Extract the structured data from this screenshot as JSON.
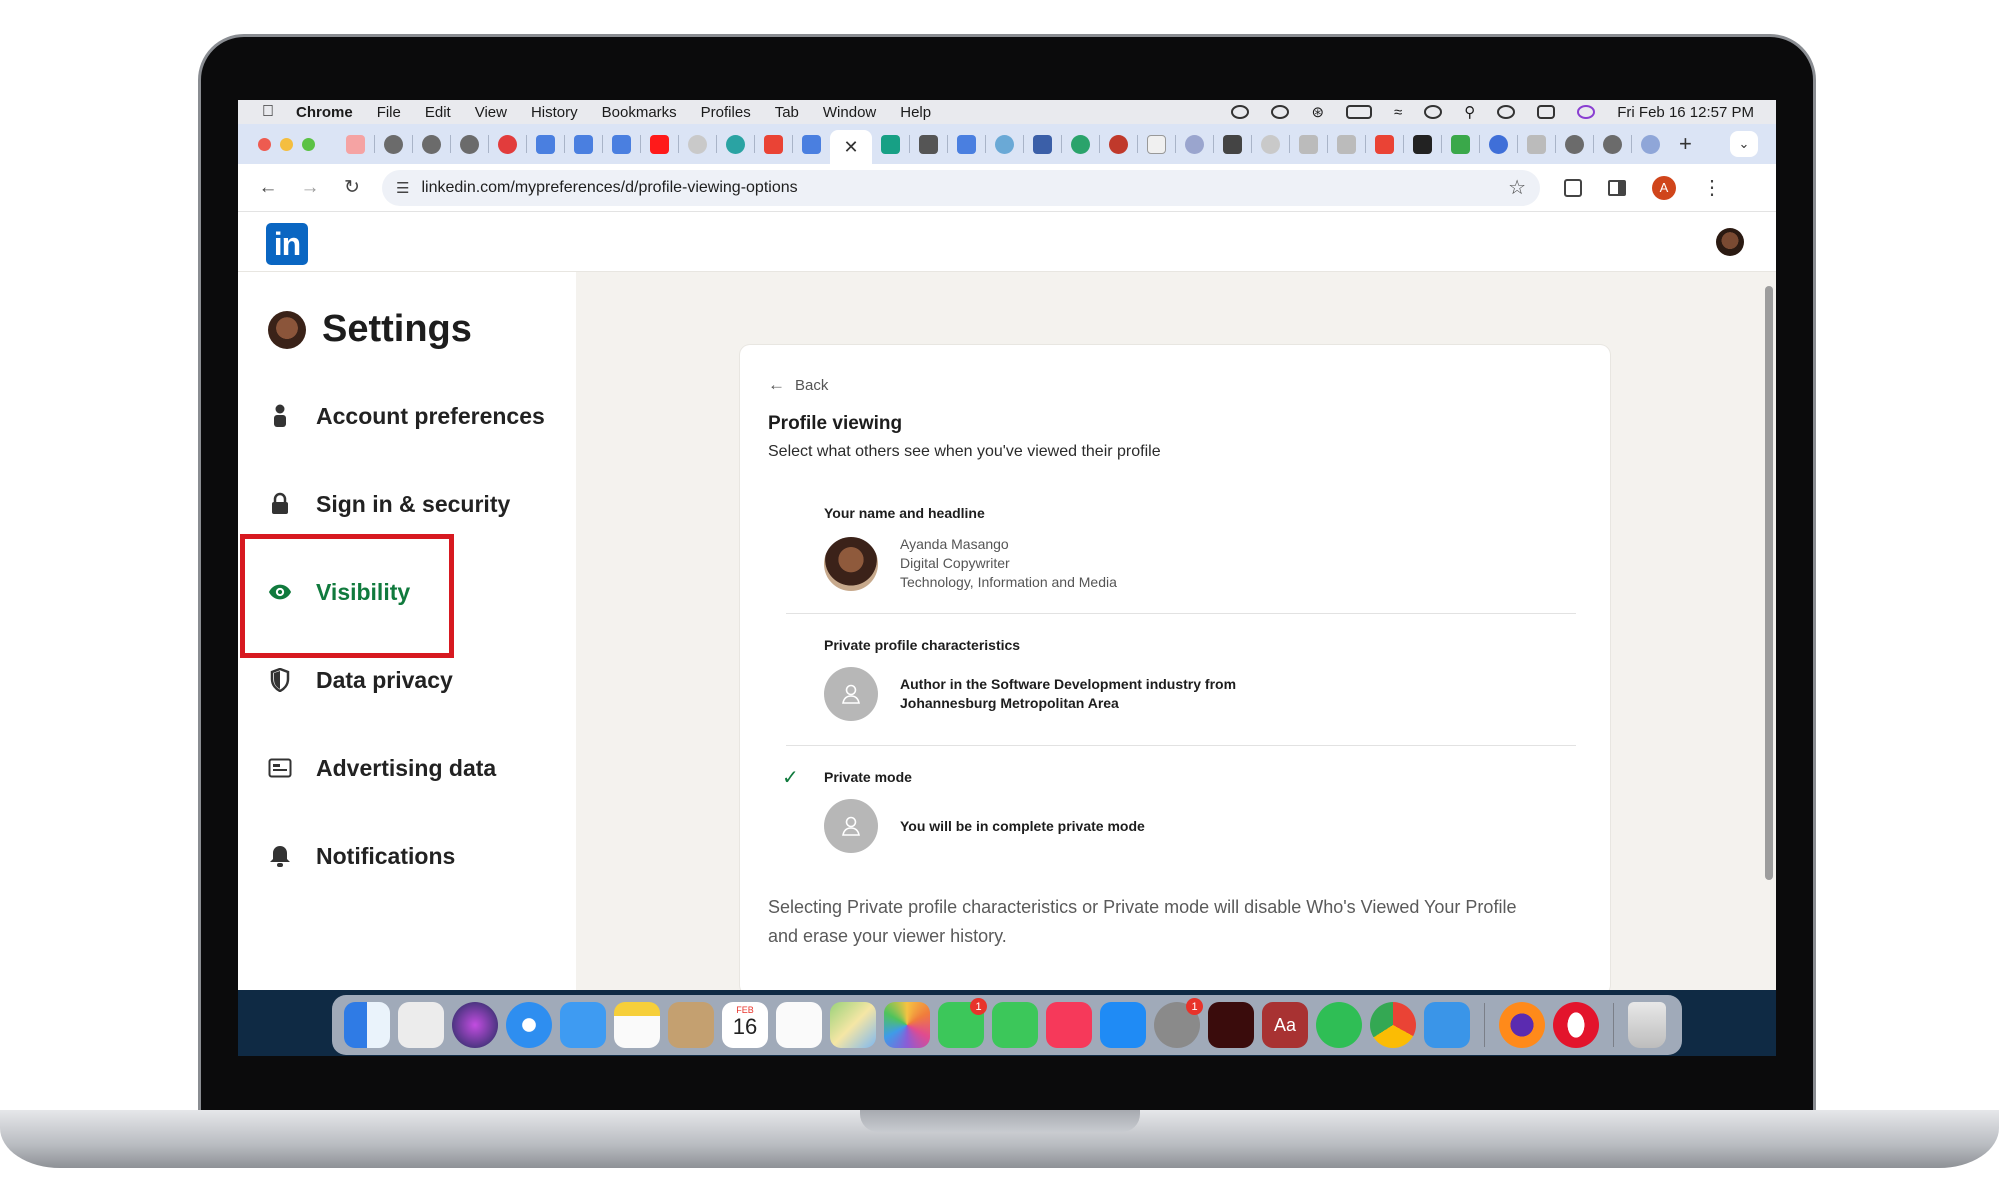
{
  "menubar": {
    "app": "Chrome",
    "items": [
      "File",
      "Edit",
      "View",
      "History",
      "Bookmarks",
      "Profiles",
      "Tab",
      "Window",
      "Help"
    ],
    "clock": "Fri Feb 16  12:57 PM"
  },
  "tabs": {
    "active_close": "✕",
    "new_tab": "+"
  },
  "toolbar": {
    "url": "linkedin.com/mypreferences/d/profile-viewing-options",
    "profile_initial": "A"
  },
  "linkedin": {
    "logo_text": "in"
  },
  "sidebar": {
    "title": "Settings",
    "items": [
      {
        "label": "Account preferences",
        "icon": "person-icon"
      },
      {
        "label": "Sign in & security",
        "icon": "lock-icon"
      },
      {
        "label": "Visibility",
        "icon": "eye-icon",
        "active": true
      },
      {
        "label": "Data privacy",
        "icon": "shield-icon"
      },
      {
        "label": "Advertising data",
        "icon": "ad-card-icon"
      },
      {
        "label": "Notifications",
        "icon": "bell-icon"
      }
    ]
  },
  "content": {
    "back": "Back",
    "title": "Profile viewing",
    "subtitle": "Select what others see when you've viewed their profile",
    "options": [
      {
        "title": "Your name and headline",
        "lines": [
          "Ayanda Masango",
          "Digital Copywriter",
          "Technology, Information and Media"
        ],
        "selected": false
      },
      {
        "title": "Private profile characteristics",
        "lines": [
          "Author in the Software Development industry from",
          "Johannesburg Metropolitan Area"
        ],
        "selected": false
      },
      {
        "title": "Private mode",
        "lines": [
          "You will be in complete private mode"
        ],
        "selected": true
      }
    ],
    "footnote": "Selecting Private profile characteristics or Private mode will disable Who's Viewed Your Profile and erase your viewer history."
  },
  "dock": {
    "calendar_month": "FEB",
    "calendar_day": "16",
    "facetime_badge": "1",
    "settings_badge": "1",
    "dictionary_label": "Aa"
  },
  "colors": {
    "linkedin_blue": "#0a66c2",
    "active_green": "#107a3d",
    "highlight_red": "#d71920",
    "page_bg": "#f4f2ee"
  }
}
